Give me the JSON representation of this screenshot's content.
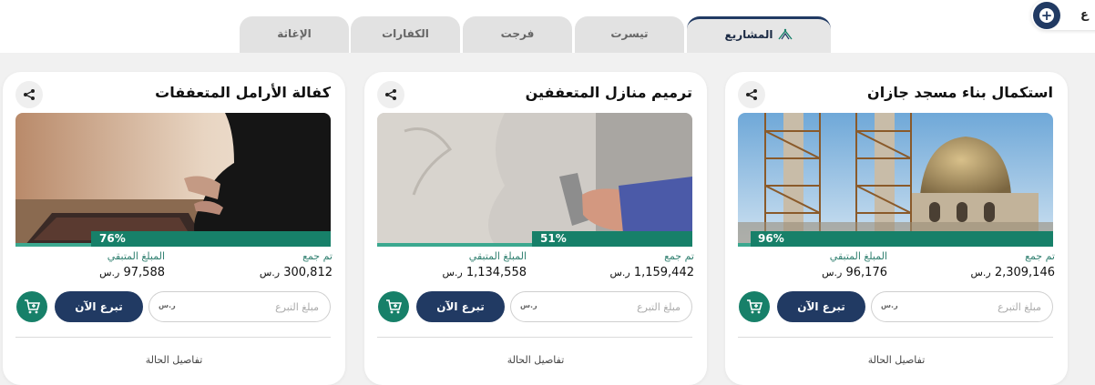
{
  "header": {
    "add_label": "ع"
  },
  "tabs": [
    {
      "label": "المشاريع",
      "active": true
    },
    {
      "label": "تيسرت",
      "active": false
    },
    {
      "label": "فرجت",
      "active": false
    },
    {
      "label": "الكفارات",
      "active": false
    },
    {
      "label": "الإغاثة",
      "active": false
    }
  ],
  "colors": {
    "primary": "#213a63",
    "accent": "#178069"
  },
  "cards": [
    {
      "title": "استكمال بناء مسجد جازان",
      "progress_label": "96%",
      "progress": 0.96,
      "collected_label": "تم جمع",
      "collected_value": "2,309,146",
      "remaining_label": "المبلغ المتبقي",
      "remaining_value": "96,176",
      "currency": "ر.س",
      "amount_placeholder": "مبلغ التبرع",
      "rs_tag": "ر.س",
      "donate_label": "تبرع الآن",
      "details_label": "تفاصيل الحالة",
      "image": "mosque-construction"
    },
    {
      "title": "ترميم منازل المتعففين",
      "progress_label": "51%",
      "progress": 0.51,
      "collected_label": "تم جمع",
      "collected_value": "1,159,442",
      "remaining_label": "المبلغ المتبقي",
      "remaining_value": "1,134,558",
      "currency": "ر.س",
      "amount_placeholder": "مبلغ التبرع",
      "rs_tag": "ر.س",
      "donate_label": "تبرع الآن",
      "details_label": "تفاصيل الحالة",
      "image": "wall-plastering"
    },
    {
      "title": "كفالة الأرامل المتعففات",
      "progress_label": "76%",
      "progress": 0.76,
      "collected_label": "تم جمع",
      "collected_value": "300,812",
      "remaining_label": "المبلغ المتبقي",
      "remaining_value": "97,588",
      "currency": "ر.س",
      "amount_placeholder": "مبلغ التبرع",
      "rs_tag": "ر.س",
      "donate_label": "تبرع الآن",
      "details_label": "تفاصيل الحالة",
      "image": "woman-praying"
    }
  ]
}
